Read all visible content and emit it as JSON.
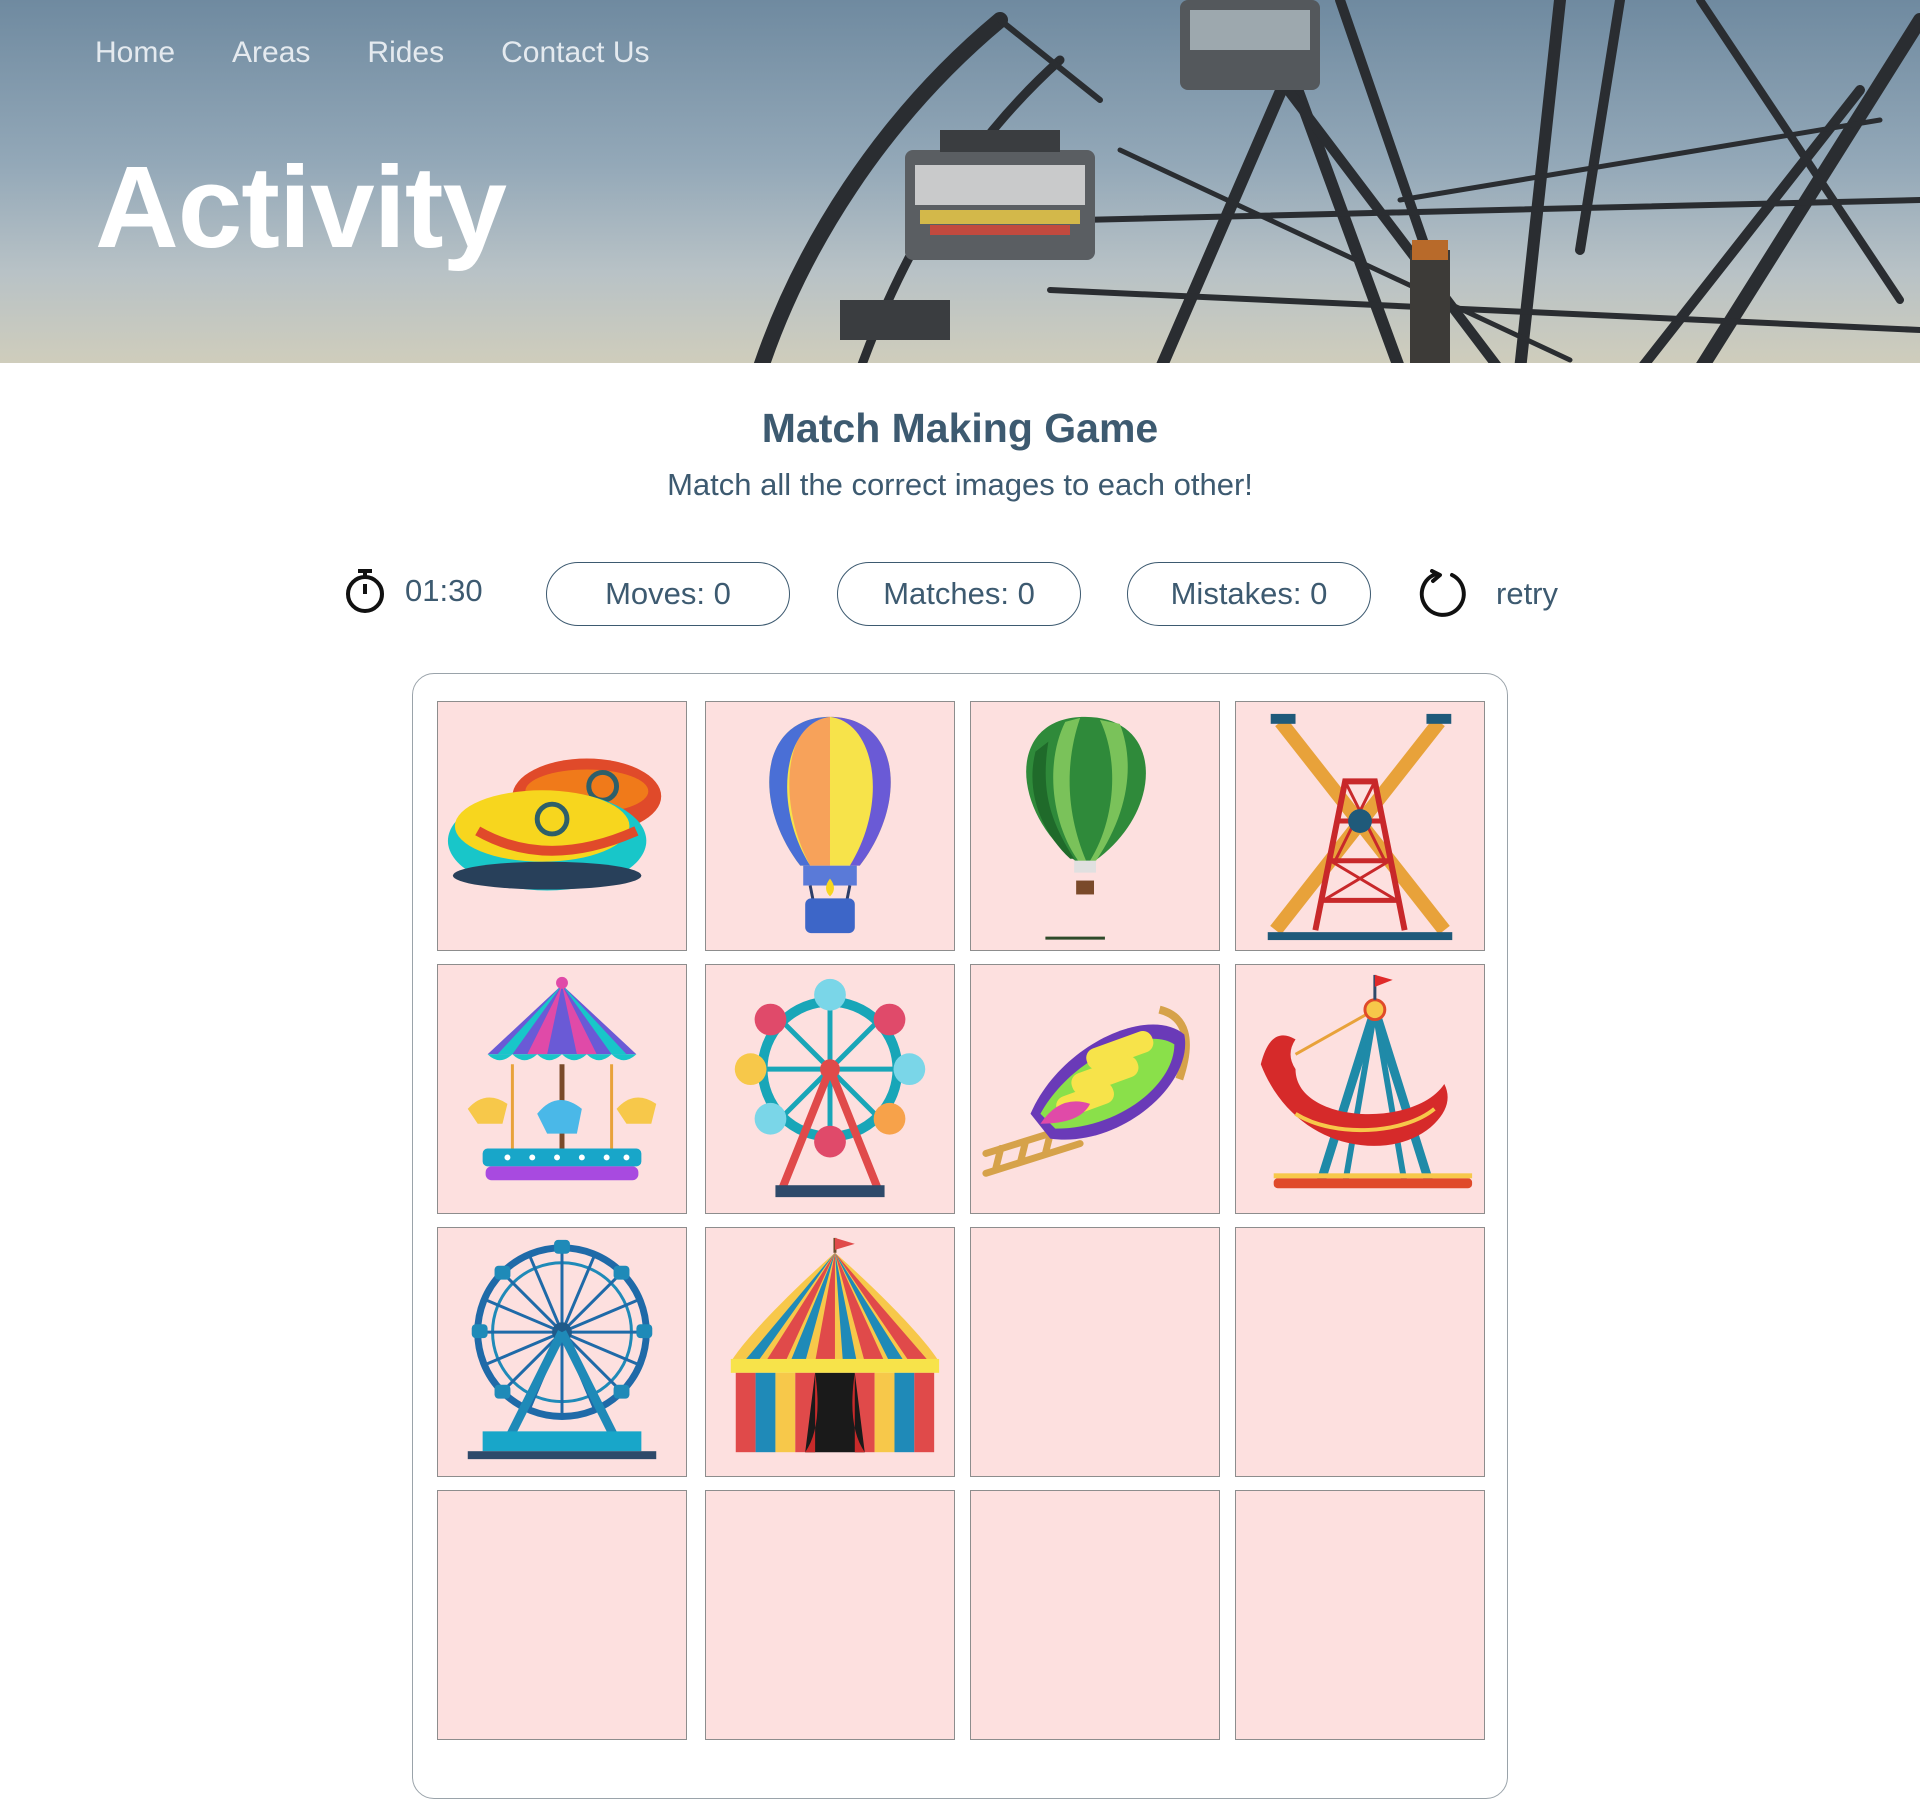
{
  "nav": {
    "items": [
      "Home",
      "Areas",
      "Rides",
      "Contact Us"
    ]
  },
  "hero": {
    "title": "Activity"
  },
  "game": {
    "title": "Match Making Game",
    "subtitle": "Match all the correct images to each other!",
    "timer": "01:30",
    "moves": "Moves: 0",
    "matches": "Matches: 0",
    "mistakes": "Mistakes: 0",
    "retry": "retry"
  },
  "board": {
    "cards": [
      {
        "icon": "bumper-cars-icon",
        "revealed": true
      },
      {
        "icon": "striped-hot-air-balloon-icon",
        "revealed": true
      },
      {
        "icon": "green-hot-air-balloon-icon",
        "revealed": true
      },
      {
        "icon": "swing-tower-ride-icon",
        "revealed": true
      },
      {
        "icon": "carousel-icon",
        "revealed": true
      },
      {
        "icon": "colorful-ferris-wheel-icon",
        "revealed": true
      },
      {
        "icon": "log-flume-boat-icon",
        "revealed": true
      },
      {
        "icon": "pirate-ship-ride-icon",
        "revealed": true
      },
      {
        "icon": "blue-ferris-wheel-icon",
        "revealed": true
      },
      {
        "icon": "circus-tent-icon",
        "revealed": true
      },
      {
        "icon": "card-back",
        "revealed": false
      },
      {
        "icon": "card-back",
        "revealed": false
      },
      {
        "icon": "card-back",
        "revealed": false
      },
      {
        "icon": "card-back",
        "revealed": false
      },
      {
        "icon": "card-back",
        "revealed": false
      },
      {
        "icon": "card-back",
        "revealed": false
      }
    ]
  },
  "colors": {
    "card_bg": "#fde0df",
    "text": "#3d5a70",
    "hero_sky": "#93a8b8"
  }
}
